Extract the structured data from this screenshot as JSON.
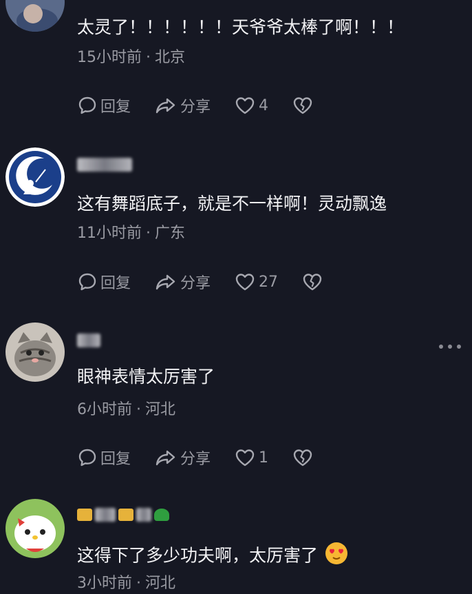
{
  "comments": [
    {
      "text": "太灵了！！！！！！天爷爷太棒了啊！！！",
      "time": "15小时前",
      "location": "北京",
      "reply_label": "回复",
      "share_label": "分享",
      "likes": "4"
    },
    {
      "text": "这有舞蹈底子，就是不一样啊！灵动飘逸",
      "time": "11小时前",
      "location": "广东",
      "reply_label": "回复",
      "share_label": "分享",
      "likes": "27"
    },
    {
      "text": "眼神表情太厉害了",
      "time": "6小时前",
      "location": "河北",
      "reply_label": "回复",
      "share_label": "分享",
      "likes": "1"
    },
    {
      "text": "这得下了多少功夫啊，太厉害了",
      "emoji": "heart-eyes-emoji",
      "time": "3小时前",
      "location": "河北"
    }
  ],
  "meta_separator": "·",
  "icons": {
    "reply": "comment-bubble-icon",
    "share": "share-arrow-icon",
    "like": "heart-outline-icon",
    "dislike": "broken-heart-icon",
    "more": "more-dots-icon"
  },
  "colors": {
    "background": "#161823",
    "text_primary": "#f2f2f4",
    "text_secondary": "#9a9ba3"
  }
}
